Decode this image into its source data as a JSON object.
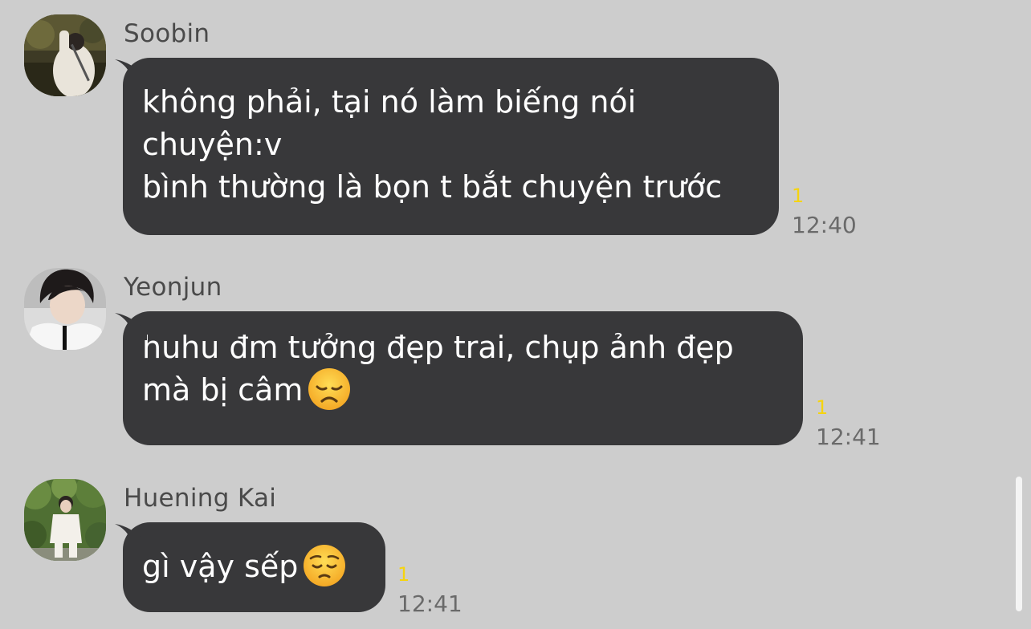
{
  "messages": [
    {
      "sender": "Soobin",
      "lines": [
        "không phải, tại nó làm biếng nói",
        "chuyện:v",
        "bình thường là bọn t bắt chuyện trước"
      ],
      "unread": "1",
      "time": "12:40"
    },
    {
      "sender": "Yeonjun",
      "lines": [
        "huhu đm tưởng đẹp trai, chụp ảnh đẹp",
        "mà bị câm"
      ],
      "emoji": "disappointed-face",
      "unread": "1",
      "time": "12:41"
    },
    {
      "sender": "Huening Kai",
      "lines": [
        "gì vậy sếp"
      ],
      "emoji": "pensive-face",
      "unread": "1",
      "time": "12:41"
    }
  ],
  "colors": {
    "background": "#cdcdcd",
    "bubble": "#38383a",
    "bubble_text": "#ffffff",
    "sender_name": "#4a4a4a",
    "unread_count": "#f5d40f",
    "timestamp": "#6a6a6a"
  }
}
